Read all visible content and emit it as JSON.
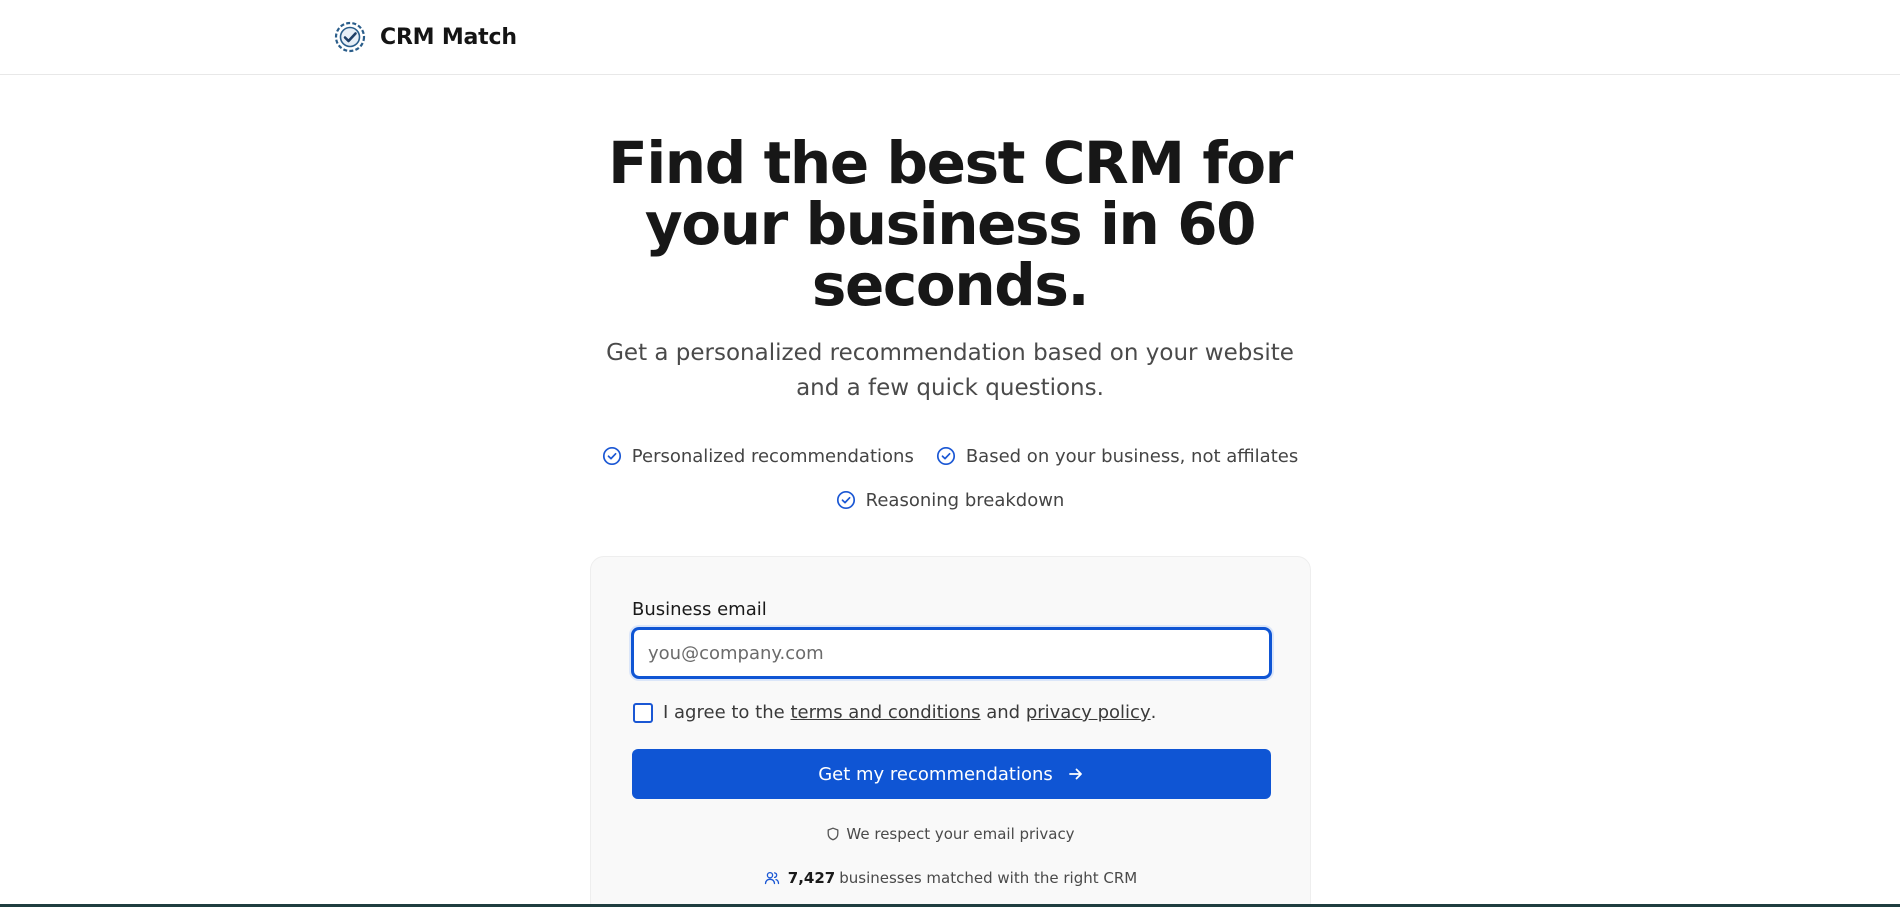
{
  "header": {
    "brand": "CRM Match"
  },
  "hero": {
    "title": "Find the best CRM for your business in 60 seconds.",
    "subtitle": "Get a personalized recommendation based on your website and a few quick questions."
  },
  "features": [
    {
      "label": "Personalized recommendations",
      "icon": "check-circle-icon"
    },
    {
      "label": "Based on your business, not affilates",
      "icon": "check-circle-icon"
    },
    {
      "label": "Reasoning breakdown",
      "icon": "check-circle-icon"
    }
  ],
  "form": {
    "email_label": "Business email",
    "email_placeholder": "you@company.com",
    "email_value": "",
    "agree_prefix": "I agree to the",
    "terms_link": "terms and conditions",
    "agree_and": "and",
    "privacy_link": "privacy policy",
    "agree_suffix": ".",
    "submit_label": "Get my recommendations",
    "privacy_note": "We respect your email privacy",
    "matched_count": "7,427",
    "matched_text": "businesses matched with the right CRM"
  },
  "colors": {
    "accent": "#0f55d4",
    "text": "#1a1a1a",
    "muted": "#4a4a4a",
    "card_bg": "#f9f9f9"
  }
}
